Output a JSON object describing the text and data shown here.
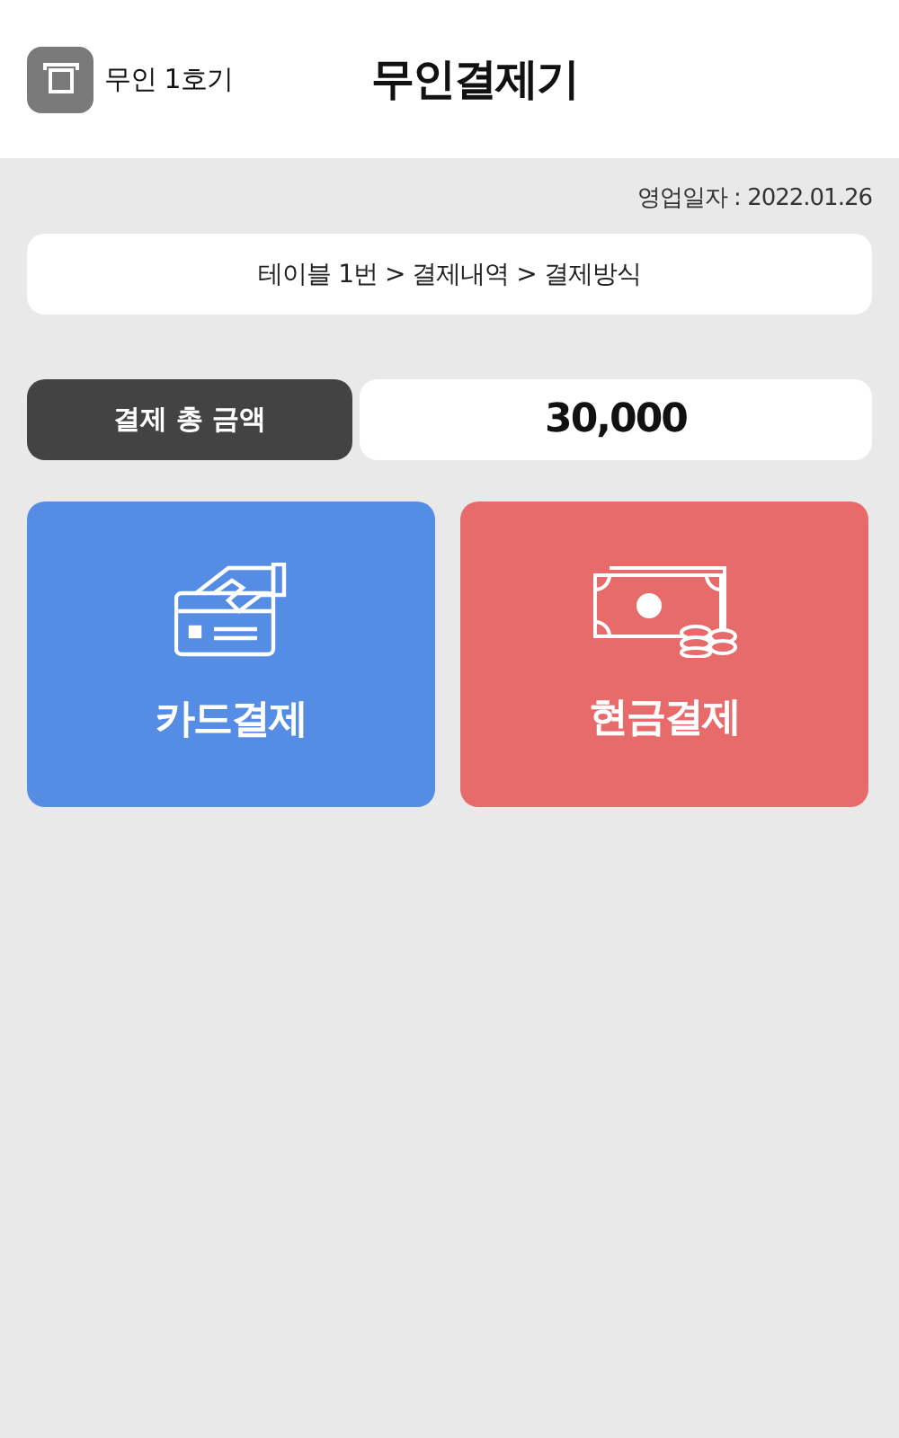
{
  "header": {
    "device_label": "무인 1호기",
    "title": "무인결제기"
  },
  "business_date": "영업일자 : 2022.01.26",
  "breadcrumb": "테이블 1번 > 결제내역 > 결제방식",
  "total": {
    "label": "결제 총 금액",
    "amount": "30,000"
  },
  "payment_methods": [
    {
      "kind": "card",
      "label": "카드결제",
      "color": "#548de3"
    },
    {
      "kind": "cash",
      "label": "현금결제",
      "color": "#e76b6b"
    }
  ]
}
